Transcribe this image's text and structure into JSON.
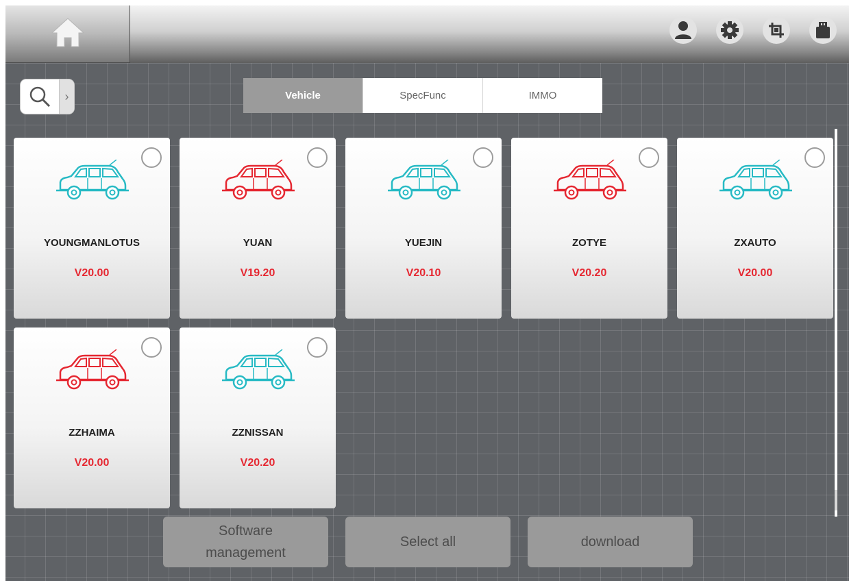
{
  "toolbar": {
    "home_icon": "home-icon",
    "right_icons": [
      "user-icon",
      "gear-icon",
      "crop-icon",
      "usb-icon"
    ]
  },
  "search": {
    "icon": "search-icon",
    "arrow": "›"
  },
  "tabs": [
    {
      "label": "Vehicle",
      "active": true
    },
    {
      "label": "SpecFunc",
      "active": false
    },
    {
      "label": "IMMO",
      "active": false
    }
  ],
  "cards": [
    {
      "name": "YOUNGMANLOTUS",
      "version": "V20.00",
      "car_color": "#27bac4",
      "selected": false
    },
    {
      "name": "YUAN",
      "version": "V19.20",
      "car_color": "#e52731",
      "selected": false
    },
    {
      "name": "YUEJIN",
      "version": "V20.10",
      "car_color": "#27bac4",
      "selected": false
    },
    {
      "name": "ZOTYE",
      "version": "V20.20",
      "car_color": "#e52731",
      "selected": false
    },
    {
      "name": "ZXAUTO",
      "version": "V20.00",
      "car_color": "#27bac4",
      "selected": false
    },
    {
      "name": "ZZHAIMA",
      "version": "V20.00",
      "car_color": "#e52731",
      "selected": false
    },
    {
      "name": "ZZNISSAN",
      "version": "V20.20",
      "car_color": "#27bac4",
      "selected": false
    }
  ],
  "actions": {
    "software_management": "Software\nmanagement",
    "select_all": "Select all",
    "download": "download"
  },
  "colors": {
    "version_red": "#e52731",
    "car_teal": "#27bac4",
    "background": "#5f6266"
  }
}
